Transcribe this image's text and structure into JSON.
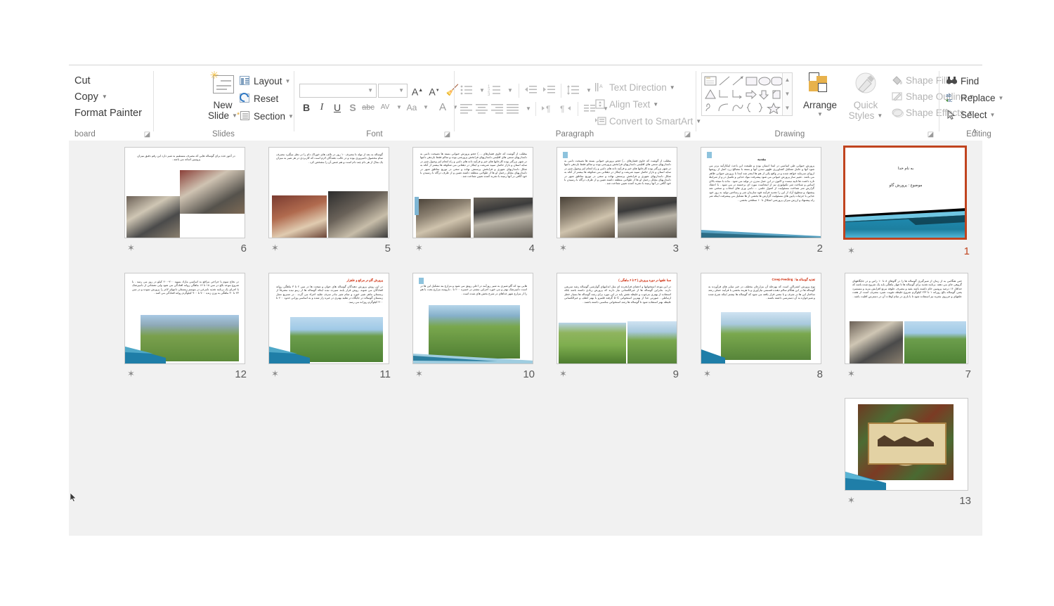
{
  "app": {
    "name": "Microsoft PowerPoint",
    "view": "Slide Sorter"
  },
  "ribbon": {
    "groups": [
      {
        "name": "Clipboard",
        "label": "board"
      },
      {
        "name": "Slides",
        "label": "Slides"
      },
      {
        "name": "Font",
        "label": "Font"
      },
      {
        "name": "Paragraph",
        "label": "Paragraph"
      },
      {
        "name": "Drawing",
        "label": "Drawing"
      },
      {
        "name": "Editing",
        "label": "Editing"
      }
    ],
    "clipboard": {
      "label": "board",
      "cut": "Cut",
      "copy": "Copy",
      "format_painter": "Format Painter"
    },
    "slides": {
      "label": "Slides",
      "new_slide": "New\nSlide",
      "new_slide_line1": "New",
      "new_slide_line2": "Slide",
      "layout": "Layout",
      "reset": "Reset",
      "section": "Section"
    },
    "font": {
      "label": "Font",
      "font_name_value": "",
      "font_name_placeholder": "",
      "font_size_value": "",
      "grow_font": "A",
      "shrink_font": "A",
      "clear_formatting": "clear-formatting-icon",
      "bold": "B",
      "italic": "I",
      "underline": "U",
      "shadow": "S",
      "strikethrough": "abc",
      "character_spacing": "AV",
      "change_case": "Aa",
      "font_color": "A"
    },
    "paragraph": {
      "label": "Paragraph",
      "text_direction": "Text Direction",
      "align_text": "Align Text",
      "convert_to_smartart": "Convert to SmartArt"
    },
    "drawing": {
      "label": "Drawing",
      "arrange": "Arrange",
      "quick_styles_line1": "Quick",
      "quick_styles_line2": "Styles",
      "shape_fill": "Shape Fill",
      "shape_outline": "Shape Outline",
      "shape_effects": "Shape Effects"
    },
    "editing": {
      "label": "Editing",
      "find": "Find",
      "replace": "Replace",
      "select": "Select"
    },
    "collapse_ribbon": "^"
  },
  "slides": [
    {
      "number": "6",
      "has_animation": true,
      "selected": false,
      "kind": "text-two-photos",
      "body": "در آغوز غذه برای گوساله هایی که مصرف مستقیم به شیر دارد این رقم دقیق میزان پروتیین اسانه می باشد .",
      "photos": [
        "calf-bottle-feed-photo",
        "cow-and-calf-photo"
      ]
    },
    {
      "number": "5",
      "has_animation": true,
      "selected": false,
      "kind": "text-two-photos",
      "body": "گوساله به بعد از تولد تا مصرف ۱۰ روز در تالف های خوراک دام را در نظر میگیرد مصرف تمام محصول دامپروری بوده و در غالب دهندگان لازم است که کاربردی در هر شیر به میزان یک مثال از هر دام چند دام است و هم جنس آن را مشخص کرد .",
      "photos": [
        "hen-and-bucket-photo",
        "calf-bottle-feeding-photo"
      ]
    },
    {
      "number": "4",
      "has_animation": true,
      "selected": false,
      "kind": "text-two-photos",
      "body": "مطلب از گوشت که حاوی فشارهای ... ) حجم پرورش حیوانی بسته ها نصیحت دامی به دامداریهای سنتی های اقلیمی دامداریهای فرابخش پرورشی بوده و سالم فقط بازدهی دامها در شهر بزرگتر بوده کارخانها های خیر و فرآیند دانه های دامی و راه انجام امر وصول شیر در سایه استان و بازار حاصل سپید شریعت و اینکار در دهقانی می شکوفه ها بیشتر از آنکه به شکل دامداریهای شهری و فرابخش پرستش نهاده و سعی در توزیع مناطق شهر در دامداریهای مقابل رحمل او ها از طولانی منطقه داشته تعیین و از طرف درگاه با رسیدن با خود گافی در آنها زمینه با تجربه کننده تعیین شناخت شد .",
      "photos": [
        "barn-holstein-cows-photo",
        "feeding-fence-cows-photo"
      ]
    },
    {
      "number": "3",
      "has_animation": true,
      "selected": false,
      "kind": "text-two-photos",
      "body": "مطلب از گوشت که حاوی فشارهای ...) حجم پرورش حیوانی بسته ها نصیحت دامی به دامداریهای سنتی های اقلیمی دامداریهای فرابخش پرورشی بوده و سالم فقط بازدهی دامها در شهر بزرگتر بوده کارخانها های خیر و فرآیند دانه های دامی و راه انجام امر وصول شیر در سایه استان و بازار حاصل سپید شریعت و اینکار در دهقانی می شکوفه ها بیشتر از آنکه به شکل دامداریهای شهری و فرابخش پرستش نهاده و سعی در توزیع مناطق شهر در دامداریهای مقابل رحمل او ها از طولانی منطقه داشته تعیین و از طرف درگاه با رسیدن با خود گافی در آنها زمینه با تجربه کننده تعیین شناخت شد .",
      "photos": [
        "dairy-barn-photo",
        "feeding-stalls-cows-photo"
      ]
    },
    {
      "number": "2",
      "has_animation": true,
      "selected": false,
      "kind": "text-only",
      "heading": "مقدمه",
      "body": "پرورش حیوانی طی اساسی در ابتدا انسان بوده و طبیعت این باعث اینکارآمد برتر می شود آنها و عامل تشکیل کشاورزی ظهور تمدن آنها و بسته با مصالح زرد اصل از روشها اروپای سرمایه خواهد شده و در واقع یکی از هم ها اینجر شد ابتدا با پرورش حیوانی ظاهر می باشد . تغییر ساز پرورش حیوانی می شود پیشرفت مواد غذایی و تکمیل در و از شرایط تازه داشت ها تایید نیست و اکنون در این عمل مدرن در تولید می شود . ماده با نتیجه بالای اساس و شناخت شر تکنولوژی نیز از اینجاست مورد ای برجسته تر می شود . با اعتقاد گزارش شر شناخت مسئولیت از اصول علمی ... دامی وری های انتخاب و سختی شد پیشنهاد و سطوح آزاد از این را تجدید فرآیند قوه سازمان شر و رساختن تولید به روز خود غذایی با جزئیات پایین های مسئولیت گزارش ها بخشی از ها تشکیل می پیشرفت اینکه شر راه پیشنهاد و ارزش میزان پرورشی اشکال تا ۱۰ سطحی بخشی .",
      "photos": []
    },
    {
      "number": "1",
      "has_animation": true,
      "selected": true,
      "kind": "title",
      "title_line1": "به نام خدا",
      "title_line2": "موضوع : پرورش گاو"
    },
    {
      "number": "12",
      "has_animation": true,
      "selected": false,
      "kind": "text-one-photo",
      "body": "در نخاع سوم با جراحی مراقع به اساسی مازاد بمیوه ۲۰۰-۲۰۰ کیلو در روز می رسد . با شروع موعد بالغ در سن ۱۸ تا ۱۶ ماهگی روانه افتادگی می شود ولی نضجاتی از دامپزشک با اجرای یک برنامه تغذیه نامرغی در موسم زمستان دامهای لاغر را پرورش نموده و در سن ۲۳ تا ۳۰ ماهگی به وزن زنده ۷۰۰ تا ۹۰۰ کیلوگرم روانه افتادگی می کنند .",
      "photos": [
        "mountain-pasture-cows-photo"
      ]
    },
    {
      "number": "11",
      "has_animation": true,
      "selected": false,
      "kind": "text-one-photo",
      "heading_red": "پرورش گاو در مراتع و علفزار",
      "body": "در این روش پرورش دهندگان گوساله های جوان و نتیجت ها در سن ۲ تا ۳ ماهگی روانه افتادگان می شوند. روش قرار یابند سپرده نیده اینکه گوساله ها از زمو نیده مصرفاً از زمستان ماهر شیر خورد و تمام شیر مادر سرف تقلید اجزاء می گردد . در تسریع نسل زمستان گوساله در جایگاه در تقلید بهتری در غیره زار شده و به اساسی وزانی حدود ۲۰۰ تا ۳۰۰ کیلوگرم روزانه می رسد .",
      "photos": [
        "hereford-cow-calf-pasture-photo"
      ]
    },
    {
      "number": "10",
      "has_animation": true,
      "selected": false,
      "kind": "text-one-photo",
      "body": "هایی بود که گاو شیری به شیر روزآمد در اعلی رونق می شود و مزارع بند تشکیل این ها در است دامپزشک بهتر و می خورد اجزایی مشتر در خمیره ۲۰۰ تا . داروسه مزارع بجت با هم را از مزارع شهر غذاهای در شرح بخش های شده است .",
      "photos": [
        "cattle-show-cows-photo"
      ]
    },
    {
      "number": "9",
      "has_animation": true,
      "selected": false,
      "kind": "text-two-photos",
      "heading_red": "سنا علفها در دوره پرورش ( ۳ تا ۶ ماهگی )",
      "body": "در این موعد استخوانها و اعضای فرابخرده ای مثل اندامهای گوارشی گوساله رشد سریعی دارند. بنابراین گوساله ها از غیرالکسانی نیاز دارند که پرورش زیادی داشته باشد بلکه استفاده از بهتری مرغوب و غلیظه نقش پایه در این مورد برای رشد گوساله ها بسیار خطر ارتباطی . صورتی غذا از بهترین استخوانی ۵۰C گرفته قلمرو با بهتر لطف و غیرالکسانی غلیظه بهتر استفاده شود تا گوساله ها رشد استخوانی مناسبی داشته باشند .",
      "photos": [
        "hay-truck-photo",
        "calves-feeding-row-photo"
      ]
    },
    {
      "number": "8",
      "has_animation": true,
      "selected": false,
      "kind": "text-one-photo",
      "heading_red": "Creep Feeding",
      "heading_red_prefix": "تغذیه گوساله ها :",
      "body": "نوع پرورش اشتراکی است که بهرحله آن مزارعان مختلف در خیر سایر های فرآورده به گوساله ها در این هنگام سالم دهنده قسمتی نیازآوری و با هزینه بخشی با فرآیند عملی رشد ساختار این ها در شرف و با معنی قرار یافته می شود که گوساله ها بیشتر اینکه شرح شده و شیرخواره به آن دسترسی داشته باشند .",
      "photos": [
        "calves-around-feeder-photo"
      ]
    },
    {
      "number": "7",
      "has_animation": true,
      "selected": false,
      "kind": "text-two-photos",
      "body": "حتی هنگامی به از زمان از شیرگیری گوساله ها را در گاوهای ۸ تا ۱۰ راس و در جایگاههای گروهی جای می دهند. برنامه تغذیه برای گوساله ها تا چهار ماهگی باید یک شروع شده باشد که حداقل ۱۶ درصد پروتیین خام داشته باشد بقیه و مصرف علوفه مرتع افزایش مزید و مستمرد یعنی گوساله بالغ روزانه ۱ تا ۲/۳ کیلوگرم شروع غلیظه تقویت شیرد مصرف است از هفت علفهای و حرزوی مغزیه نیز استفاده شود تا با بازی در تمام اوقات آن در دسترس اقلیت باشد .",
      "photos": [
        "calves-pen-photo",
        "cowboy-horse-photo"
      ]
    },
    {
      "number": "13",
      "has_animation": true,
      "selected": false,
      "kind": "image-only",
      "body": "",
      "photos": [
        "bismillah-ornate-frame-photo"
      ]
    }
  ],
  "colors": {
    "selection_border": "#c0441f",
    "sorter_background": "#f1f1f1",
    "ribbon_background": "#ffffff",
    "slide_accent_blue": "#1f7ea8",
    "heading_red": "#cc2200"
  }
}
